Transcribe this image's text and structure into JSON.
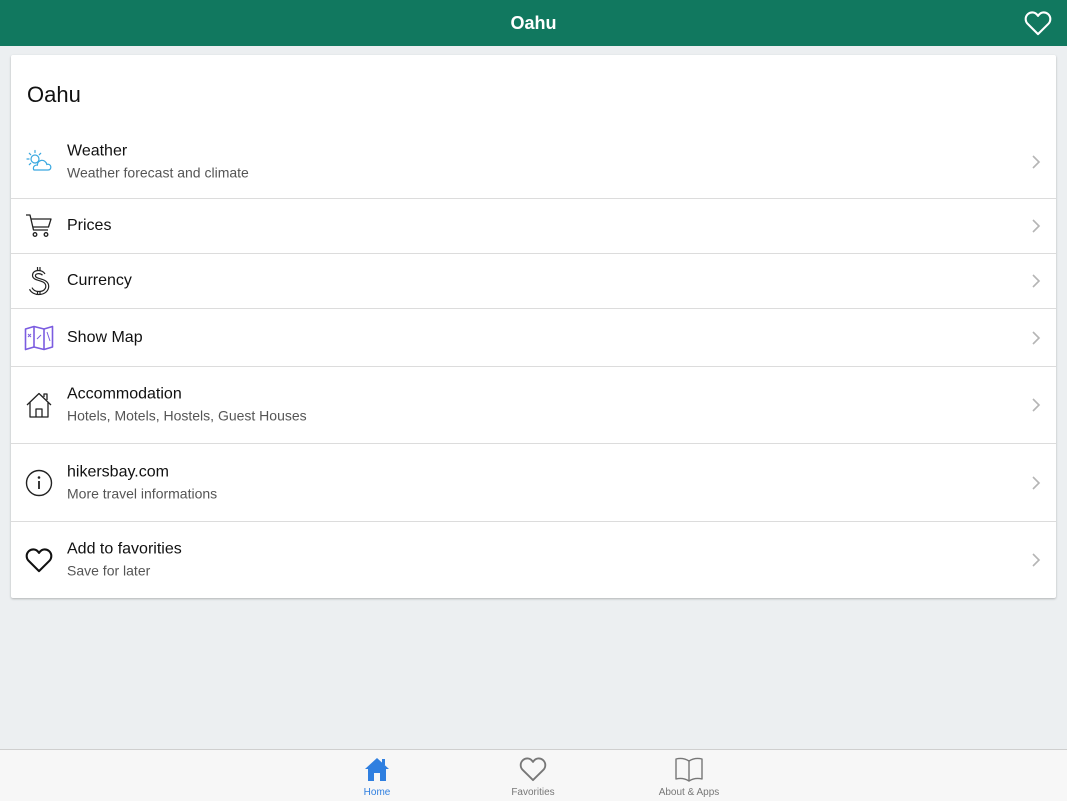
{
  "header": {
    "title": "Oahu",
    "favorite_icon": "heart-outline-icon"
  },
  "card": {
    "title": "Oahu",
    "items": [
      {
        "label": "Weather",
        "sub": "Weather forecast and climate",
        "icon": "weather-icon"
      },
      {
        "label": "Prices",
        "sub": "",
        "icon": "cart-icon"
      },
      {
        "label": "Currency",
        "sub": "",
        "icon": "dollar-icon"
      },
      {
        "label": "Show Map",
        "sub": "",
        "icon": "map-icon"
      },
      {
        "label": "Accommodation",
        "sub": "Hotels, Motels, Hostels, Guest Houses",
        "icon": "house-icon"
      },
      {
        "label": "hikersbay.com",
        "sub": "More travel informations",
        "icon": "info-icon"
      },
      {
        "label": "Add to favorities",
        "sub": "Save for later",
        "icon": "heart-icon"
      }
    ]
  },
  "tabs": [
    {
      "label": "Home",
      "icon": "home-icon",
      "active": true
    },
    {
      "label": "Favorities",
      "icon": "heart-icon",
      "active": false
    },
    {
      "label": "About & Apps",
      "icon": "book-icon",
      "active": false
    }
  ],
  "colors": {
    "header": "#11785f",
    "active_tab": "#2f7fe0",
    "map_icon": "#7b5ce0",
    "weather_icon": "#3aa8e0"
  }
}
